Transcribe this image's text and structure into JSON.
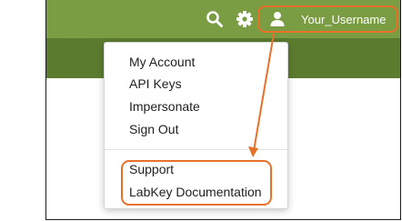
{
  "header": {
    "username": "Your_Username",
    "icons": {
      "search": "search-icon",
      "settings": "gear-icon",
      "user": "user-icon"
    }
  },
  "menu": {
    "account_items": [
      "My Account",
      "API Keys",
      "Impersonate",
      "Sign Out"
    ],
    "help_items": [
      "Support",
      "LabKey Documentation"
    ]
  },
  "colors": {
    "header_bg": "#7a9c43",
    "subheader_bg": "#5b7b2e",
    "highlight": "#e8712a"
  }
}
